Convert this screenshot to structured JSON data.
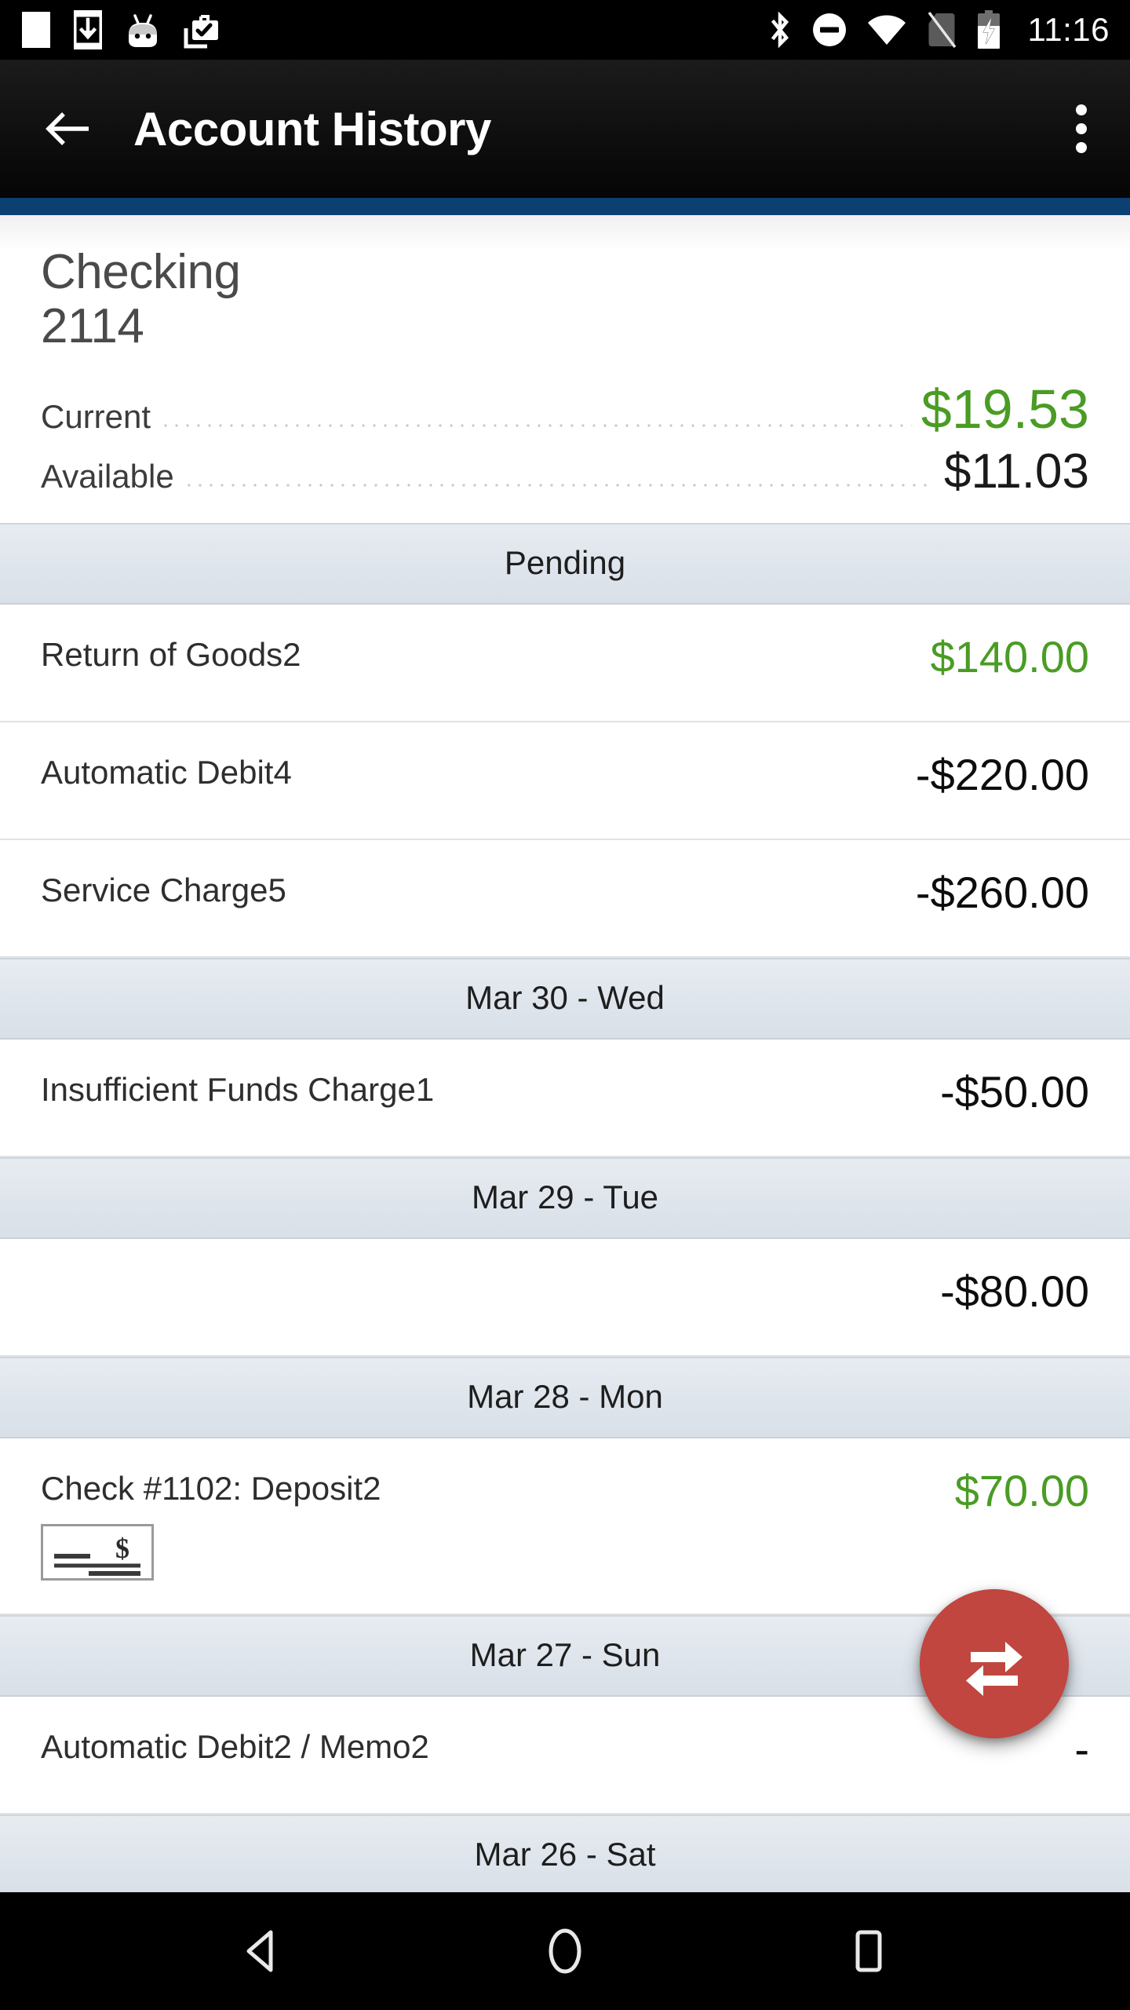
{
  "status_bar": {
    "left_icons": [
      "notification-square-icon",
      "download-to-phone-icon",
      "android-head-icon",
      "work-profile-check-icon"
    ],
    "right_icons": [
      "bluetooth-icon",
      "do-not-disturb-icon",
      "wifi-icon",
      "no-sim-icon",
      "battery-charging-icon"
    ],
    "time": "11:16"
  },
  "app_bar": {
    "back_label": "Navigate up",
    "title": "Account History",
    "overflow_label": "More options",
    "accent_color": "#0c3f72"
  },
  "account": {
    "name": "Checking",
    "number": "2114",
    "balances": [
      {
        "label": "Current",
        "value": "$19.53",
        "tone": "credit"
      },
      {
        "label": "Available",
        "value": "$11.03",
        "tone": "debit"
      }
    ]
  },
  "colors": {
    "credit_green": "#4a9c24",
    "debit_black": "#0d0d0d",
    "fab_red": "#c0463f",
    "section_bg": "#dfe5ec"
  },
  "sections": [
    {
      "header": "Pending",
      "rows": [
        {
          "desc": "Return of Goods2",
          "amount": "$140.00",
          "tone": "credit",
          "has_check_image": false
        },
        {
          "desc": "Automatic Debit4",
          "amount": "-$220.00",
          "tone": "debit",
          "has_check_image": false
        },
        {
          "desc": "Service Charge5",
          "amount": "-$260.00",
          "tone": "debit",
          "has_check_image": false
        }
      ]
    },
    {
      "header": "Mar 30 - Wed",
      "rows": [
        {
          "desc": "Insufficient Funds Charge1",
          "amount": "-$50.00",
          "tone": "debit",
          "has_check_image": false
        }
      ]
    },
    {
      "header": "Mar 29 - Tue",
      "rows": [
        {
          "desc": "",
          "amount": "-$80.00",
          "tone": "debit",
          "has_check_image": false
        }
      ]
    },
    {
      "header": "Mar 28 - Mon",
      "rows": [
        {
          "desc": "Check #1102: Deposit2",
          "amount": "$70.00",
          "tone": "credit",
          "has_check_image": true
        }
      ]
    },
    {
      "header": "Mar 27 - Sun",
      "rows": [
        {
          "desc": "Automatic Debit2 / Memo2",
          "amount": "-",
          "tone": "debit",
          "has_check_image": false
        }
      ]
    },
    {
      "header": "Mar 26 - Sat",
      "rows": []
    }
  ],
  "fab": {
    "label": "Transfer",
    "icon": "transfer-arrows-icon"
  },
  "nav_bar": {
    "back_label": "Back",
    "home_label": "Home",
    "recents_label": "Recent apps"
  }
}
